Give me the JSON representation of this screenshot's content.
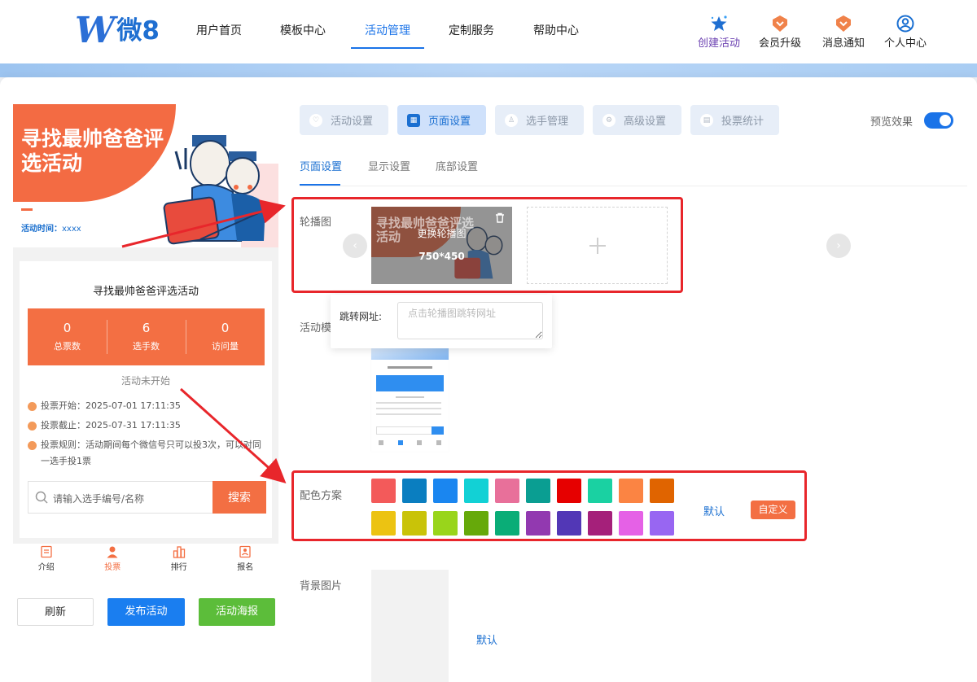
{
  "header": {
    "logo_mark": "W",
    "logo_text": "微8",
    "nav": [
      "用户首页",
      "模板中心",
      "活动管理",
      "定制服务",
      "帮助中心"
    ],
    "active_nav": "活动管理",
    "actions": [
      {
        "label": "创建活动",
        "icon": "star-icon",
        "color": "#6a3fb0"
      },
      {
        "label": "会员升级",
        "icon": "vip-badge-icon",
        "color": "#f0824a"
      },
      {
        "label": "消息通知",
        "icon": "notification-badge-icon",
        "color": "#f0824a"
      },
      {
        "label": "个人中心",
        "icon": "user-circle-icon",
        "color": "#1a6fd1"
      }
    ]
  },
  "preview": {
    "hero_title": "寻找最帅爸爸评选活动",
    "hero_time_label": "活动时间：",
    "hero_time_value": "xxxx",
    "card_title": "寻找最帅爸爸评选活动",
    "stats": [
      {
        "value": "0",
        "label": "总票数"
      },
      {
        "value": "6",
        "label": "选手数"
      },
      {
        "value": "0",
        "label": "访问量"
      }
    ],
    "status": "活动未开始",
    "info": [
      "投票开始：2025-07-01 17:11:35",
      "投票截止：2025-07-31 17:11:35",
      "投票规则：活动期间每个微信号只可以投3次，可以对同一选手投1票"
    ],
    "search_placeholder": "请输入选手编号/名称",
    "search_button": "搜索",
    "tabbar": [
      {
        "label": "介绍",
        "icon": "document-icon"
      },
      {
        "label": "投票",
        "icon": "person-icon"
      },
      {
        "label": "排行",
        "icon": "bar-chart-icon"
      },
      {
        "label": "报名",
        "icon": "signup-icon"
      }
    ],
    "active_tab": "投票"
  },
  "bottom_buttons": [
    {
      "label": "刷新",
      "color": "#ffffff"
    },
    {
      "label": "发布活动",
      "color": "#1a7ef0"
    },
    {
      "label": "活动海报",
      "color": "#5cbd3a"
    }
  ],
  "steps": [
    {
      "label": "活动设置",
      "icon": "heart-icon"
    },
    {
      "label": "页面设置",
      "icon": "layout-icon"
    },
    {
      "label": "选手管理",
      "icon": "user-icon"
    },
    {
      "label": "高级设置",
      "icon": "settings-icon"
    },
    {
      "label": "投票统计",
      "icon": "stats-icon"
    }
  ],
  "active_step": "页面设置",
  "preview_toggle": {
    "label": "预览效果",
    "on": true
  },
  "subtabs": [
    "页面设置",
    "显示设置",
    "底部设置"
  ],
  "active_subtab": "页面设置",
  "carousel": {
    "label": "轮播图",
    "image_title": "寻找最帅爸爸评选活动",
    "change_label": "更换轮播图",
    "size": "750*450",
    "jump_label": "跳转网址:",
    "jump_placeholder": "点击轮播图跳转网址"
  },
  "template_label": "活动模",
  "color_scheme": {
    "label": "配色方案",
    "colors": [
      "#f35a5a",
      "#0a7ec0",
      "#1a86f0",
      "#12d1d5",
      "#e8709a",
      "#0a9e92",
      "#e60000",
      "#1ad1a2",
      "#fb8443",
      "#e06400",
      "#ecc312",
      "#c9c308",
      "#99d51b",
      "#66a90a",
      "#0aad77",
      "#9239b0",
      "#5237b6",
      "#a5207a",
      "#e561e6",
      "#9866f2"
    ],
    "default_label": "默认",
    "custom_label": "自定义"
  },
  "background": {
    "label": "背景图片",
    "default_label": "默认"
  },
  "colors": {
    "accent": "#1a73e8",
    "orange": "#f36f43",
    "highlight": "#e8262b"
  }
}
